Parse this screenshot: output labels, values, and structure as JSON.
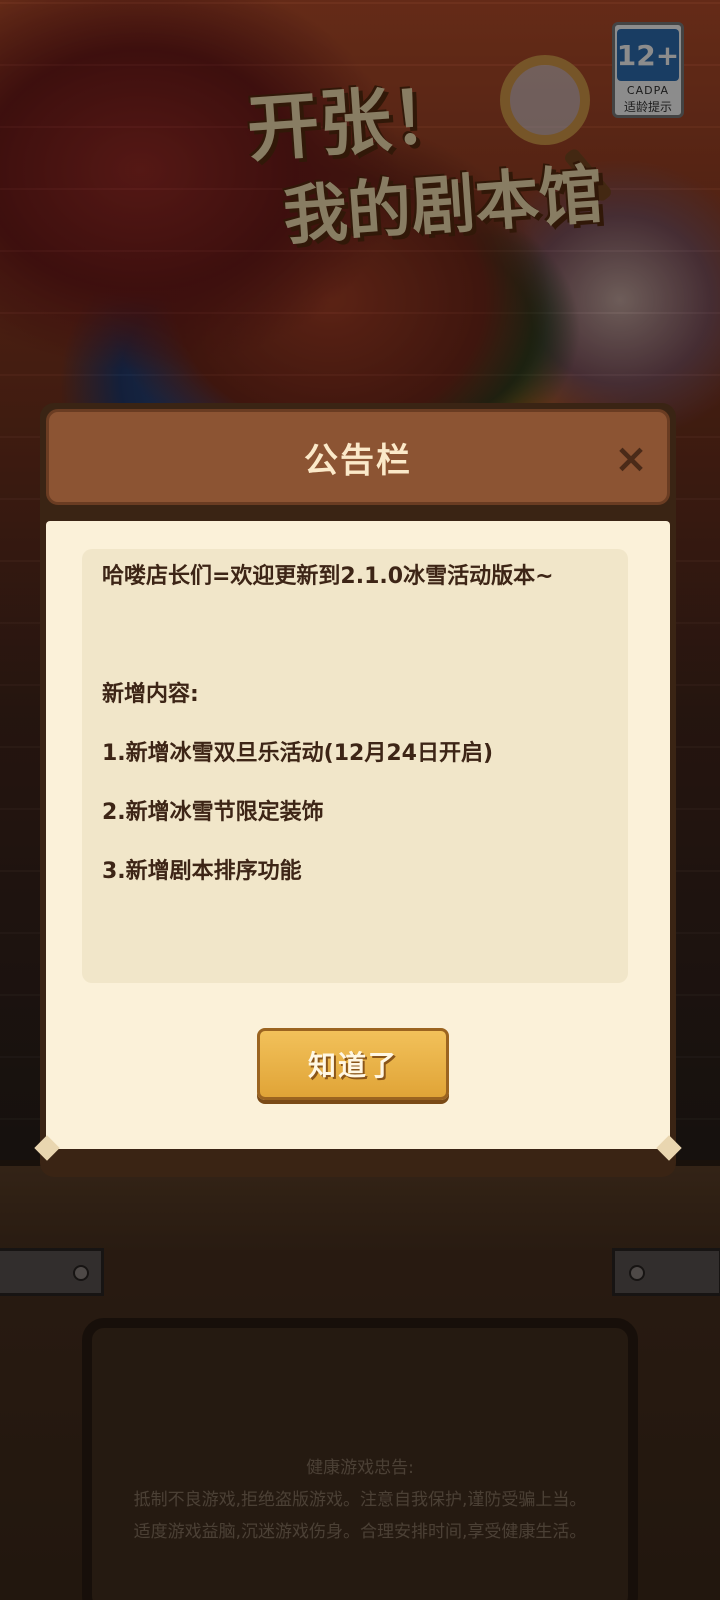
{
  "game": {
    "title_line1": "开张！",
    "title_line2": "我的剧本馆"
  },
  "age_rating": {
    "age": "12+",
    "org": "CADPA",
    "tip": "适龄提示"
  },
  "dialog": {
    "title": "公告栏",
    "close_label": "×",
    "lines": [
      "哈喽店长们=欢迎更新到2.1.0冰雪活动版本~",
      "新增内容:",
      "1.新增冰雪双旦乐活动(12月24日开启)",
      "2.新增冰雪节限定装饰",
      "3.新增剧本排序功能"
    ],
    "confirm_label": "知道了"
  },
  "health_notice": {
    "heading": "健康游戏忠告:",
    "line1": "抵制不良游戏,拒绝盗版游戏。注意自我保护,谨防受骗上当。",
    "line2": "适度游戏益脑,沉迷游戏伤身。合理安排时间,享受健康生活。"
  },
  "colors": {
    "header": "#8c5433",
    "paper": "#fbf1d9",
    "button": "#e0a437",
    "text": "#3d2516"
  }
}
